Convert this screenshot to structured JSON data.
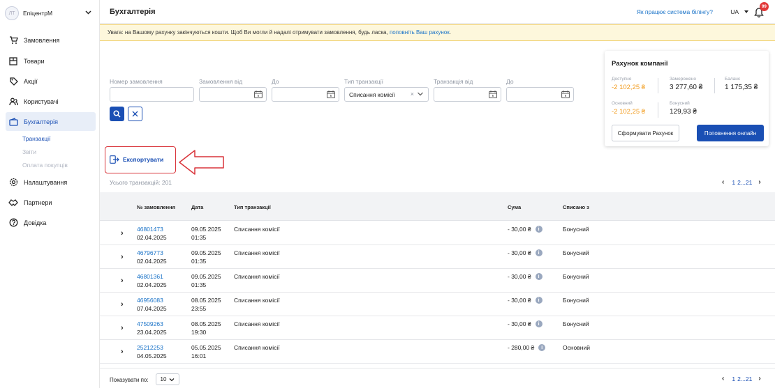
{
  "brand": {
    "logo_text": "ЛТ",
    "name": "ЕпіцентрМ"
  },
  "sidebar": {
    "items": [
      {
        "label": "Замовлення",
        "icon": "cart-icon"
      },
      {
        "label": "Товари",
        "icon": "box-icon"
      },
      {
        "label": "Акції",
        "icon": "discount-icon"
      },
      {
        "label": "Користувачі",
        "icon": "users-icon"
      },
      {
        "label": "Бухгалтерія",
        "icon": "wallet-icon"
      },
      {
        "label": "Налаштування",
        "icon": "gear-icon"
      },
      {
        "label": "Партнери",
        "icon": "handshake-icon"
      },
      {
        "label": "Довідка",
        "icon": "help-icon"
      }
    ],
    "subitems": [
      "Транзакції",
      "Звіти",
      "Оплата покупців"
    ]
  },
  "header": {
    "title": "Бухгалтерія",
    "billing_link": "Як працює система білінгу?",
    "lang": "UA",
    "notifications": "99"
  },
  "warning": {
    "text": "Увага: на Вашому рахунку закінчуються кошти. Щоб Ви могли й надалі отримувати замовлення, будь ласка, ",
    "link": "поповніть Ваш рахунок",
    "end": "."
  },
  "filters": {
    "order_number": "Номер замовлення",
    "order_from": "Замовлення від",
    "to1": "До",
    "tx_type": "Тип транзакції",
    "tx_type_value": "Списання комісії",
    "tx_from": "Транзакція від",
    "to2": "До"
  },
  "account": {
    "title": "Рахунок компанії",
    "available_label": "Доступно",
    "available_value": "-2 102,25 ₴",
    "frozen_label": "Заморожено",
    "frozen_value": "3 277,60 ₴",
    "balance_label": "Баланс",
    "balance_value": "1 175,35 ₴",
    "main_label": "Основний",
    "main_value": "-2 102,25 ₴",
    "bonus_label": "Бонусний",
    "bonus_value": "129,93 ₴",
    "btn_invoice": "Сформувати Рахунок",
    "btn_topup": "Поповнення онлайн"
  },
  "export_label": "Експортувати",
  "total": "Усього транзакцій: 201",
  "pagination": {
    "current": "1",
    "rest": "2...21"
  },
  "table": {
    "headers": [
      "№ замовлення",
      "Дата",
      "Тип транзакції",
      "Сума",
      "Списано з"
    ],
    "rows": [
      {
        "order": "46801473",
        "order_date": "02.04.2025",
        "date": "09.05.2025",
        "time": "01:35",
        "type": "Списання комісії",
        "sum": "- 30,00 ₴",
        "source": "Бонусний"
      },
      {
        "order": "46796773",
        "order_date": "02.04.2025",
        "date": "09.05.2025",
        "time": "01:35",
        "type": "Списання комісії",
        "sum": "- 30,00 ₴",
        "source": "Бонусний"
      },
      {
        "order": "46801361",
        "order_date": "02.04.2025",
        "date": "09.05.2025",
        "time": "01:35",
        "type": "Списання комісії",
        "sum": "- 30,00 ₴",
        "source": "Бонусний"
      },
      {
        "order": "46956083",
        "order_date": "07.04.2025",
        "date": "08.05.2025",
        "time": "23:55",
        "type": "Списання комісії",
        "sum": "- 30,00 ₴",
        "source": "Бонусний"
      },
      {
        "order": "47509263",
        "order_date": "23.04.2025",
        "date": "08.05.2025",
        "time": "19:30",
        "type": "Списання комісії",
        "sum": "- 30,00 ₴",
        "source": "Бонусний"
      },
      {
        "order": "25212253",
        "order_date": "04.05.2025",
        "date": "05.05.2025",
        "time": "16:01",
        "type": "Списання комісії",
        "sum": "- 280,00 ₴",
        "source": "Основний"
      }
    ]
  },
  "footer": {
    "per_page_label": "Показувати по:",
    "per_page_value": "10"
  },
  "colors": {
    "primary": "#1a4fb4",
    "link": "#1a73c8",
    "warning_bg": "#fdf7dc",
    "negative": "#f29c1f",
    "annotation": "#d9343a"
  }
}
